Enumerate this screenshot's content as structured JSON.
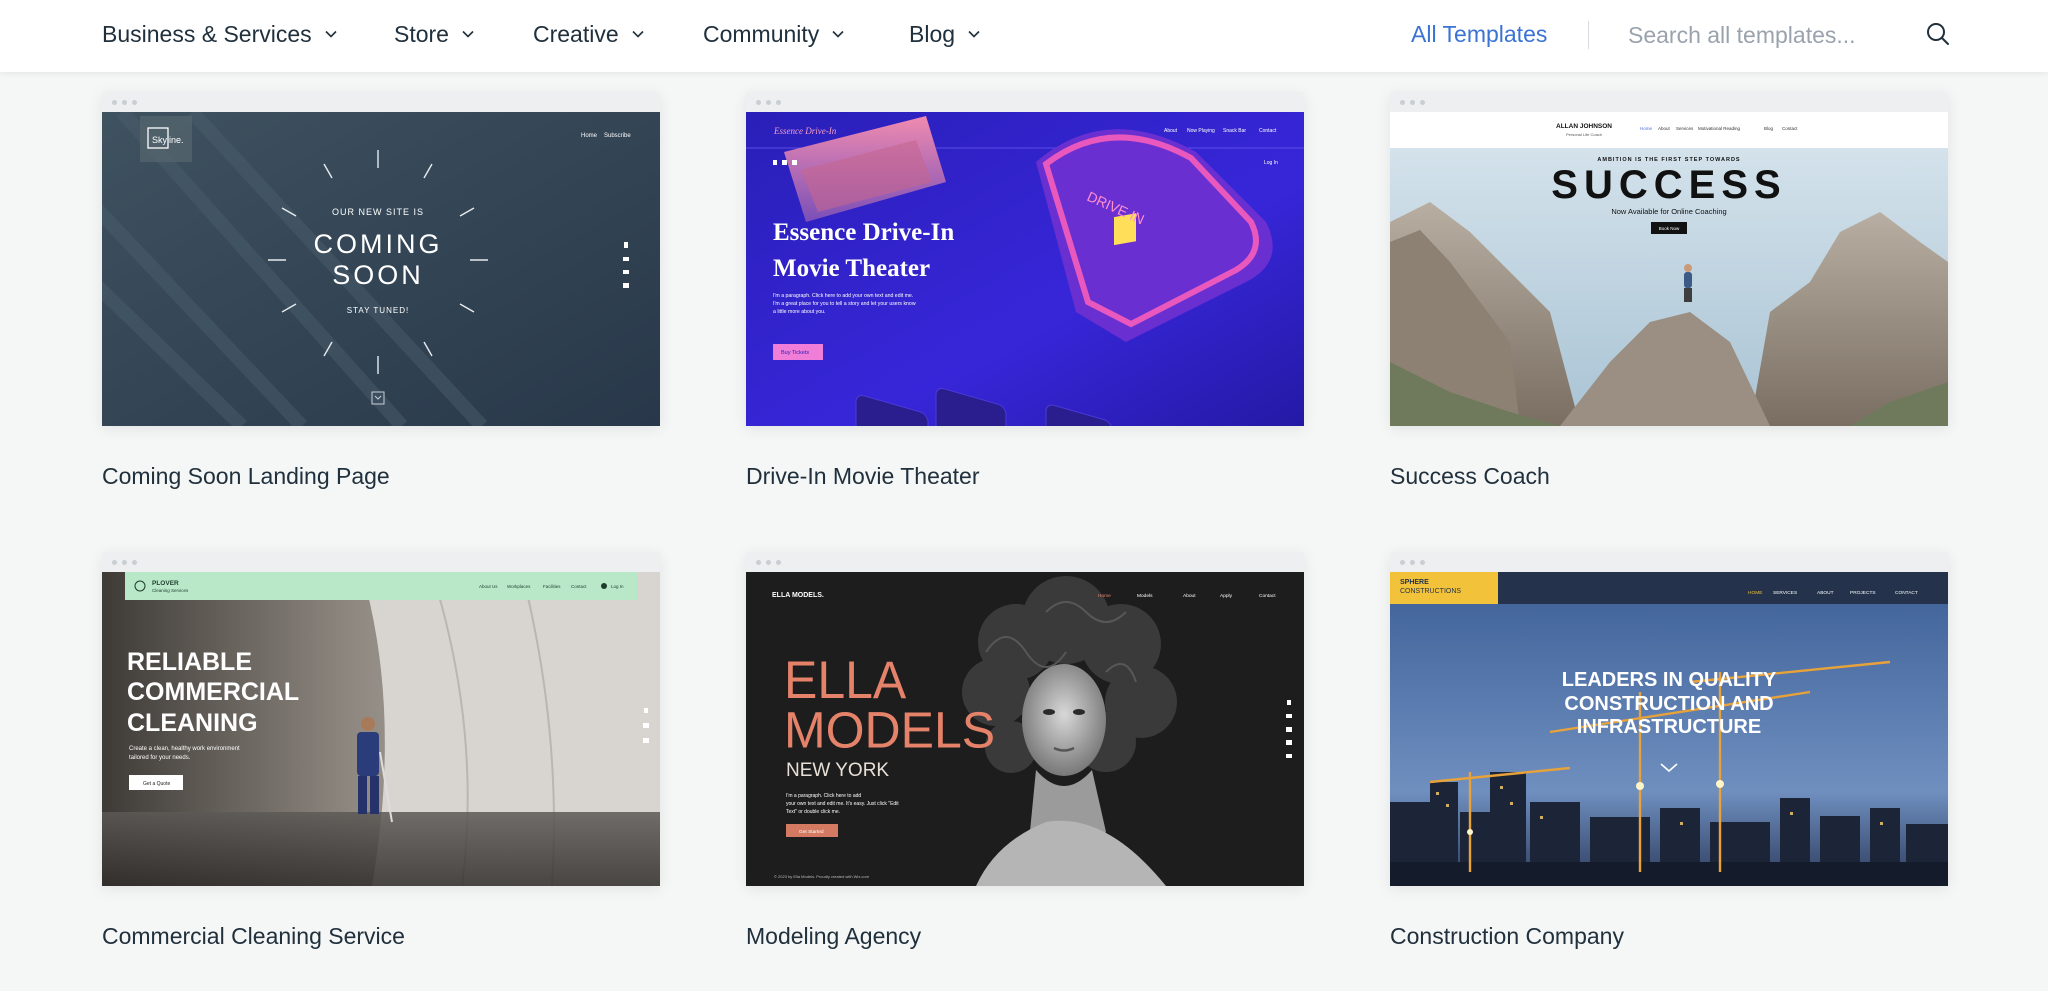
{
  "nav": {
    "items": [
      {
        "label": "Business & Services"
      },
      {
        "label": "Store"
      },
      {
        "label": "Creative"
      },
      {
        "label": "Community"
      },
      {
        "label": "Blog"
      }
    ],
    "all_templates": "All Templates",
    "search_placeholder": "Search all templates..."
  },
  "templates": [
    {
      "title": "Coming Soon Landing Page",
      "preview": {
        "logo": "Skyline.",
        "nav": [
          "Home",
          "Subscribe"
        ],
        "kicker": "OUR NEW SITE IS",
        "headline1": "COMING",
        "headline2": "SOON",
        "tagline": "STAY TUNED!"
      }
    },
    {
      "title": "Drive-In Movie Theater",
      "preview": {
        "logo": "Essence Drive-In",
        "nav": [
          "About",
          "Now Playing",
          "Snack Bar",
          "Contact"
        ],
        "login": "Log In",
        "headline1": "Essence Drive-In",
        "headline2": "Movie Theater",
        "body": [
          "I'm a paragraph. Click here to add your own text and edit me.",
          "I'm a great place for you to tell a story and let your users know",
          "a little more about you."
        ],
        "cta": "Buy Tickets",
        "sign": "DRIVE IN"
      }
    },
    {
      "title": "Success Coach",
      "preview": {
        "brand": "ALLAN JOHNSON",
        "brand_sub": "Personal Life Coach",
        "nav": [
          "Home",
          "About",
          "Services",
          "Motivational Reading",
          "Blog",
          "Contact"
        ],
        "kicker": "AMBITION IS THE FIRST STEP TOWARDS",
        "headline": "SUCCESS",
        "sub": "Now Available for Online Coaching",
        "cta": "Book Now"
      }
    },
    {
      "title": "Commercial Cleaning Service",
      "preview": {
        "brand": "PLOVER",
        "brand_sub": "Cleaning Services",
        "nav": [
          "About Us",
          "Workplaces",
          "Facilities",
          "Contact",
          "Log In"
        ],
        "headline": [
          "RELIABLE",
          "COMMERCIAL",
          "CLEANING"
        ],
        "body": [
          "Create a clean, healthy work environment",
          "tailored for your needs."
        ],
        "cta": "Get a Quote"
      }
    },
    {
      "title": "Modeling Agency",
      "preview": {
        "brand": "ELLA MODELS.",
        "nav": [
          "Home",
          "Models",
          "About",
          "Apply",
          "Contact"
        ],
        "headline1": "ELLA",
        "headline2": "MODELS",
        "headline3": "NEW YORK",
        "body": [
          "I'm a paragraph. Click here to add",
          "your own text and edit me. It's easy. Just click \"Edit",
          "Text\" or double click me."
        ],
        "cta": "Get Started",
        "footer": "© 2023 by Ella Models. Proudly created with Wix.com"
      }
    },
    {
      "title": "Construction Company",
      "preview": {
        "brand1": "SPHERE",
        "brand2": "CONSTRUCTIONS",
        "nav": [
          "HOME",
          "SERVICES",
          "ABOUT",
          "PROJECTS",
          "CONTACT"
        ],
        "headline": [
          "LEADERS IN QUALITY",
          "CONSTRUCTION AND",
          "INFRASTRUCTURE"
        ]
      }
    }
  ]
}
